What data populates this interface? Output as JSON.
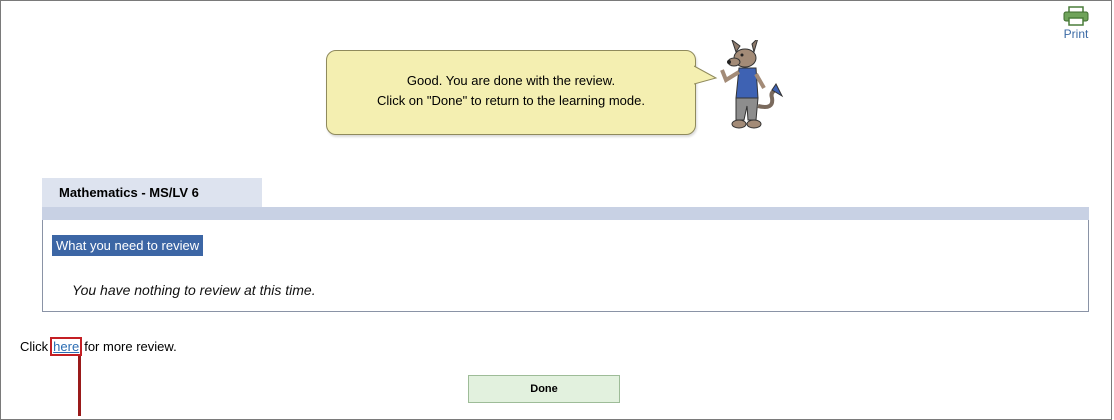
{
  "toolbar": {
    "print_label": "Print"
  },
  "bubble": {
    "line1": "Good. You are done with the review.",
    "line2": "Click on \"Done\" to return to the learning mode."
  },
  "tab": {
    "label": "Mathematics - MS/LV 6"
  },
  "review": {
    "heading": "What you need to review",
    "message": "You have nothing to review at this time."
  },
  "footer": {
    "prefix": "Click",
    "link": "here",
    "suffix": "for more review."
  },
  "done_label": "Done",
  "colors": {
    "bubble_fill": "#f4efb1",
    "tab_fill": "#dde3ef",
    "heading_highlight": "#3c66a5",
    "done_fill": "#e2f1de",
    "callout_red": "#c41f24"
  }
}
